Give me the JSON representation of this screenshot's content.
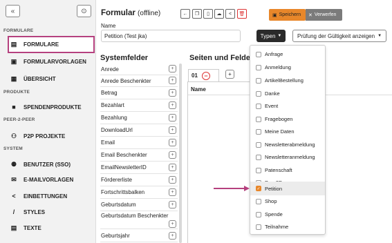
{
  "sidebar": {
    "collapse_icon": "«",
    "user_icon": "⊙",
    "sections": [
      {
        "label": "FORMULARE"
      },
      {
        "label": "PRODUKTE"
      },
      {
        "label": "PEER-2-PEER"
      },
      {
        "label": "SYSTEM"
      }
    ],
    "items": [
      {
        "label": "FORMULARE",
        "icon": "form-icon"
      },
      {
        "label": "FORMULARVORLAGEN",
        "icon": "template-icon"
      },
      {
        "label": "ÜBERSICHT",
        "icon": "overview-icon"
      },
      {
        "label": "SPENDENPRODUKTE",
        "icon": "gift-icon"
      },
      {
        "label": "P2P PROJEKTE",
        "icon": "people-icon"
      },
      {
        "label": "BENUTZER (SSO)",
        "icon": "users-icon"
      },
      {
        "label": "E-MAILVORLAGEN",
        "icon": "mail-icon"
      },
      {
        "label": "EINBETTUNGEN",
        "icon": "share-icon"
      },
      {
        "label": "STYLES",
        "icon": "brush-icon"
      },
      {
        "label": "TEXTE",
        "icon": "text-icon"
      }
    ]
  },
  "header": {
    "title": "Formular",
    "status": "(offline)",
    "save_label": "Speichern",
    "discard_label": "Verwerfen"
  },
  "form": {
    "name_label": "Name",
    "name_value": "Petition (Test jka)",
    "types_button": "Typen",
    "validate_button": "Prüfung der Gültigkeit anzeigen"
  },
  "system_fields": {
    "title": "Systemfelder",
    "items": [
      "Anrede",
      "Anrede Beschenkter",
      "Betrag",
      "Bezahlart",
      "Bezahlung",
      "DownloadUrl",
      "Email",
      "Email Beschenkter",
      "EmailNewsletterID",
      "Fördererliste",
      "Fortschrittsbalken",
      "Geburtsdatum",
      "Geburtsdatum Beschenkter",
      "Geburtsjahr"
    ]
  },
  "pages": {
    "title": "Seiten und Felder",
    "tab_label": "01",
    "column_name": "Name"
  },
  "types_dropdown": {
    "items": [
      {
        "label": "Anfrage",
        "checked": false
      },
      {
        "label": "Anmeldung",
        "checked": false
      },
      {
        "label": "ArtikelBestellung",
        "checked": false
      },
      {
        "label": "Danke",
        "checked": false
      },
      {
        "label": "Event",
        "checked": false
      },
      {
        "label": "Fragebogen",
        "checked": false
      },
      {
        "label": "Meine Daten",
        "checked": false
      },
      {
        "label": "Newsletterabmeldung",
        "checked": false
      },
      {
        "label": "Newsletteranmeldung",
        "checked": false
      },
      {
        "label": "Patenschaft",
        "checked": false
      },
      {
        "label": "Peer2Peer",
        "checked": false
      },
      {
        "label": "Petition",
        "checked": true
      },
      {
        "label": "Shop",
        "checked": false
      },
      {
        "label": "Spende",
        "checked": false
      },
      {
        "label": "Teilnahme",
        "checked": false
      }
    ]
  },
  "colors": {
    "accent": "#e8872a",
    "highlight": "#b5407e",
    "dark_button": "#2a2a2a"
  }
}
